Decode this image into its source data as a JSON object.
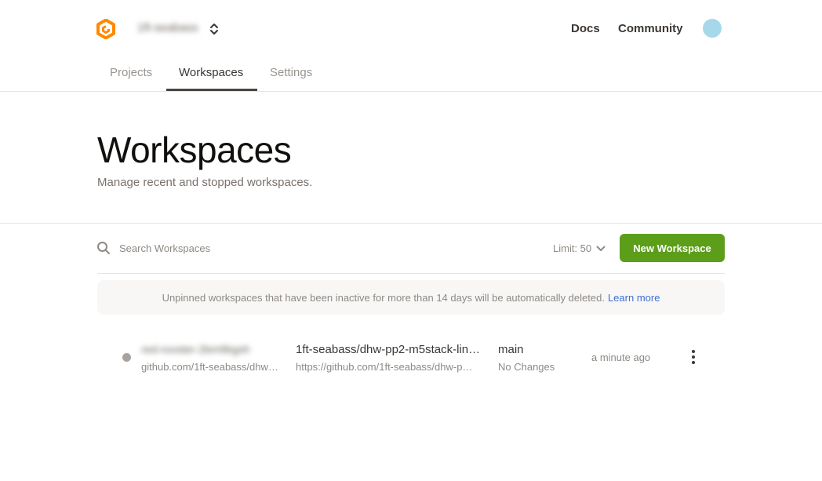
{
  "header": {
    "org_name": "1ft-seabass",
    "nav": {
      "docs": "Docs",
      "community": "Community"
    }
  },
  "tabs": [
    {
      "label": "Projects",
      "active": false
    },
    {
      "label": "Workspaces",
      "active": true
    },
    {
      "label": "Settings",
      "active": false
    }
  ],
  "page": {
    "title": "Workspaces",
    "subtitle": "Manage recent and stopped workspaces."
  },
  "toolbar": {
    "search_placeholder": "Search Workspaces",
    "limit_label": "Limit: 50",
    "new_button": "New Workspace",
    "new_button_color": "#5c9e1a"
  },
  "notice": {
    "text": "Unpinned workspaces that have been inactive for more than 14 days will be automatically deleted.",
    "link": "Learn more"
  },
  "workspaces": [
    {
      "id": "red-rooster-2bm9bgsh",
      "repo_url_short": "github.com/1ft-seabass/dhw…",
      "context": "1ft-seabass/dhw-pp2-m5stack-lin…",
      "context_url": "https://github.com/1ft-seabass/dhw-p…",
      "branch": "main",
      "changes": "No Changes",
      "last_active": "a minute ago",
      "status_color": "#a8a29e"
    }
  ]
}
